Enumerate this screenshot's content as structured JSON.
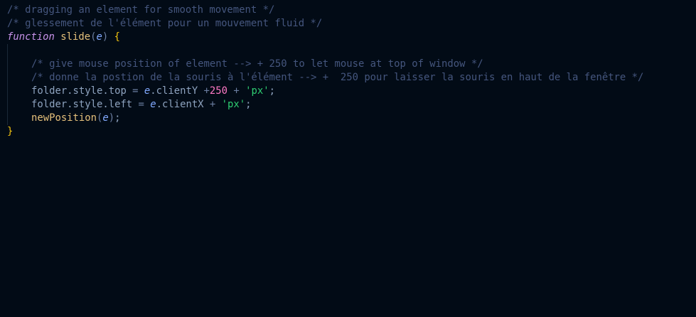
{
  "code": {
    "line1": "/* dragging an element for smooth movement */",
    "line2": "/* glessement de l'élément pour un mouvement fluid */",
    "line3": {
      "keyword": "function",
      "name": "slide",
      "open_paren": "(",
      "param": "e",
      "close_paren": ")",
      "brace": "{"
    },
    "line5": "/* give mouse position of element --> + 250 to let mouse at top of window */",
    "line6": "/* donne la postion de la souris à l'élément --> +  250 pour laisser la souris en haut de la fenêtre */",
    "line7": {
      "target": "folder.style.top",
      "eq": " = ",
      "param": "e",
      "prop": ".clientY",
      "plus1": " +",
      "number": "250",
      "plus2": " + ",
      "string": "'px'",
      "semi": ";"
    },
    "line8": {
      "target": "folder.style.left",
      "eq": " = ",
      "param": "e",
      "prop": ".clientX",
      "plus": " + ",
      "string": "'px'",
      "semi": ";"
    },
    "line9": {
      "call": "newPosition",
      "open_paren": "(",
      "param": "e",
      "close_paren": ")",
      "semi": ";"
    },
    "line10": "}"
  }
}
